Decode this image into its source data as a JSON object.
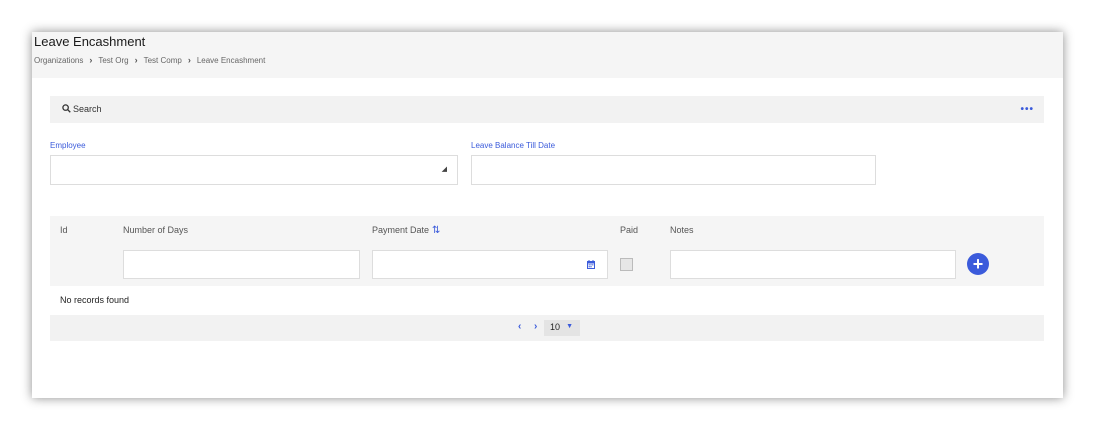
{
  "header": {
    "title": "Leave Encashment",
    "breadcrumb": [
      "Organizations",
      "Test Org",
      "Test Comp",
      "Leave Encashment"
    ]
  },
  "search": {
    "label": "Search"
  },
  "form": {
    "employee_label": "Employee",
    "employee_value": "",
    "leave_balance_label": "Leave Balance Till Date",
    "leave_balance_value": ""
  },
  "grid": {
    "columns": [
      "Id",
      "Number of Days",
      "Payment Date",
      "Paid",
      "Notes"
    ],
    "empty_message": "No records found"
  },
  "paginator": {
    "rows_per_page": "10"
  },
  "colors": {
    "accent": "#3b5bdb",
    "header_bg": "#f5f5f5"
  },
  "icons": [
    "search-icon",
    "more-icon",
    "resize-icon",
    "sort-icon",
    "calendar-icon",
    "add-icon",
    "chevron-left-icon",
    "chevron-right-icon",
    "caret-down-icon"
  ]
}
